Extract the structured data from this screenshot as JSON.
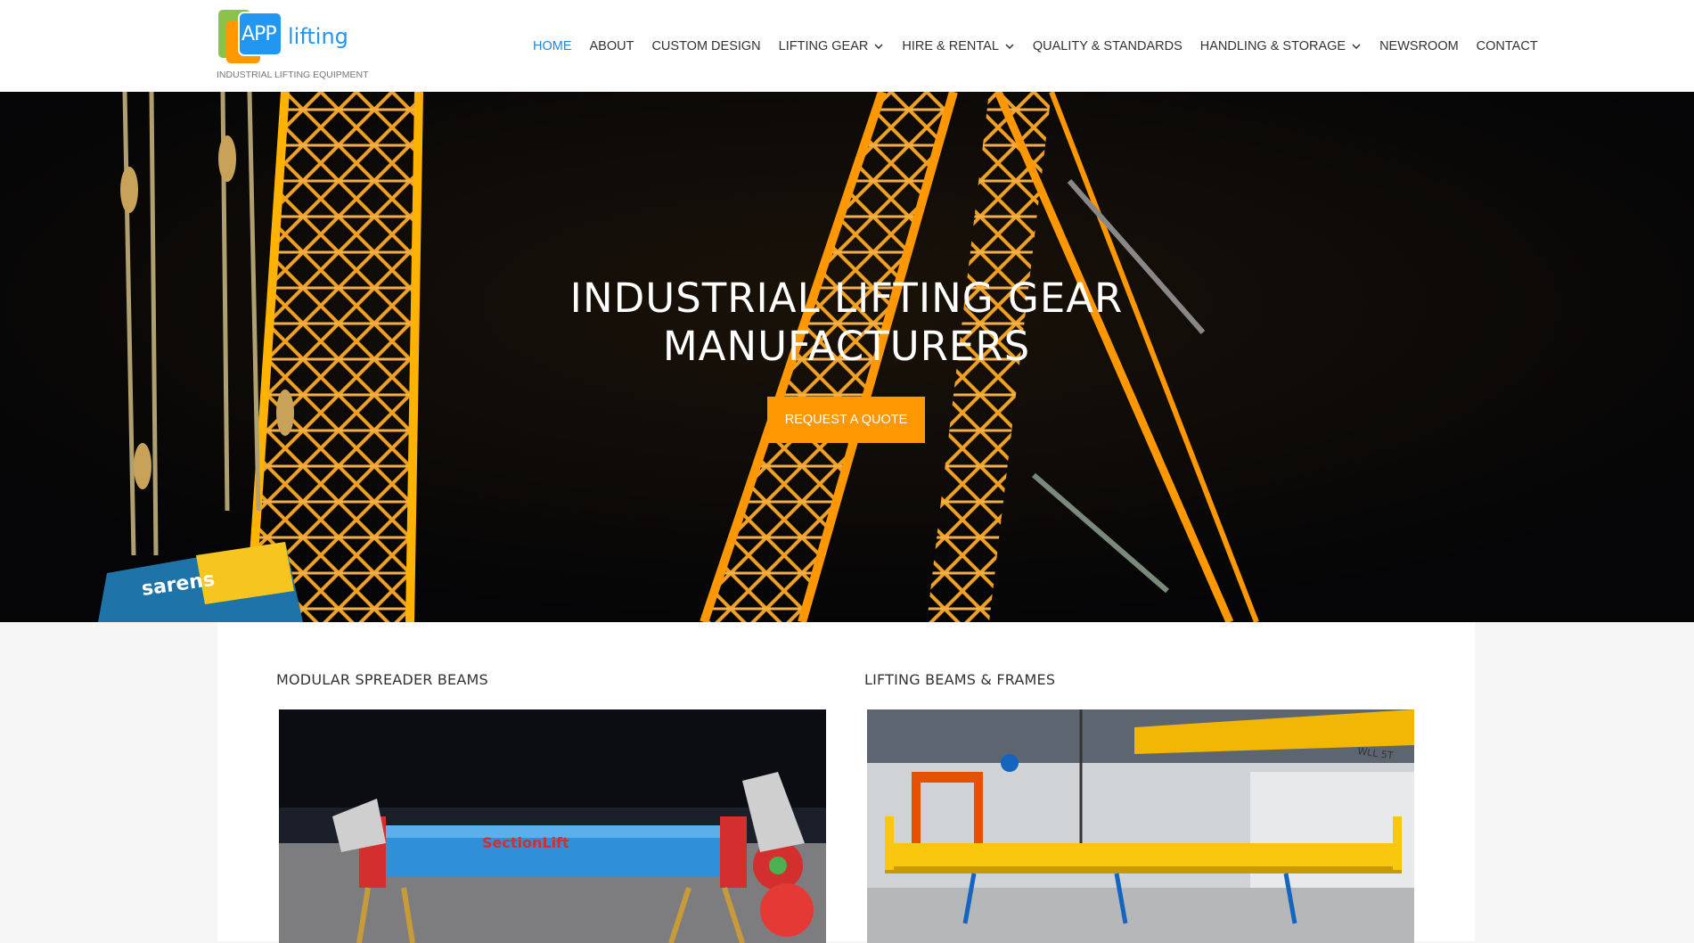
{
  "logo": {
    "letters": "APP",
    "word": "lifting",
    "tagline": "INDUSTRIAL LIFTING EQUIPMENT"
  },
  "nav": {
    "items": [
      {
        "label": "HOME",
        "dropdown": false,
        "active": true
      },
      {
        "label": "ABOUT",
        "dropdown": false
      },
      {
        "label": "CUSTOM DESIGN",
        "dropdown": false
      },
      {
        "label": "LIFTING GEAR",
        "dropdown": true
      },
      {
        "label": "HIRE & RENTAL",
        "dropdown": true
      },
      {
        "label": "QUALITY & STANDARDS",
        "dropdown": false
      },
      {
        "label": "HANDLING & STORAGE",
        "dropdown": true
      },
      {
        "label": "NEWSROOM",
        "dropdown": false
      },
      {
        "label": "CONTACT",
        "dropdown": false
      }
    ]
  },
  "hero": {
    "title_line1": "INDUSTRIAL LIFTING GEAR",
    "title_line2": "MANUFACTURERS",
    "cta_label": "REQUEST A QUOTE",
    "crane_text": "sarens"
  },
  "cards": [
    {
      "title": "MODULAR SPREADER BEAMS",
      "image_text": "SectionLift"
    },
    {
      "title": "LIFTING BEAMS & FRAMES",
      "image_text": "WLL 5T"
    }
  ],
  "colors": {
    "accent_blue": "#1e88e5",
    "cta_orange": "#ff9800",
    "crane_orange": "#f7a21b"
  }
}
